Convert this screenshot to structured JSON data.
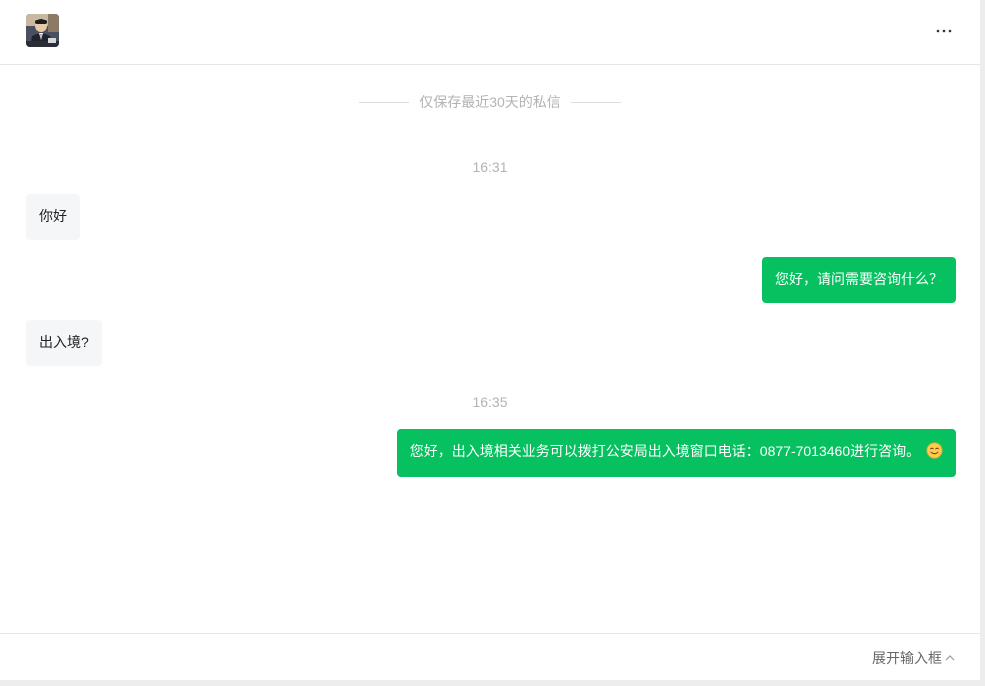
{
  "header": {
    "avatar_alt": "contact avatar",
    "more_icon": "more-horizontal-icon"
  },
  "notice": {
    "text": "仅保存最近30天的私信"
  },
  "messages": [
    {
      "type": "time",
      "text": "16:31"
    },
    {
      "type": "in",
      "text": "你好"
    },
    {
      "type": "out",
      "text": "您好，请问需要咨询什么？"
    },
    {
      "type": "in",
      "text": "出入境?"
    },
    {
      "type": "time",
      "text": "16:35"
    },
    {
      "type": "out",
      "text": "您好，出入境相关业务可以拨打公安局出入境窗口电话：0877-7013460进行咨询。",
      "emoji": "smile-emoji-icon"
    }
  ],
  "footer": {
    "expand_label": "展开输入框",
    "expand_icon": "chevron-up-icon"
  },
  "colors": {
    "outgoing_bubble": "#07c160",
    "incoming_bubble": "#f5f6f7",
    "muted_text": "#b3b3b3"
  }
}
